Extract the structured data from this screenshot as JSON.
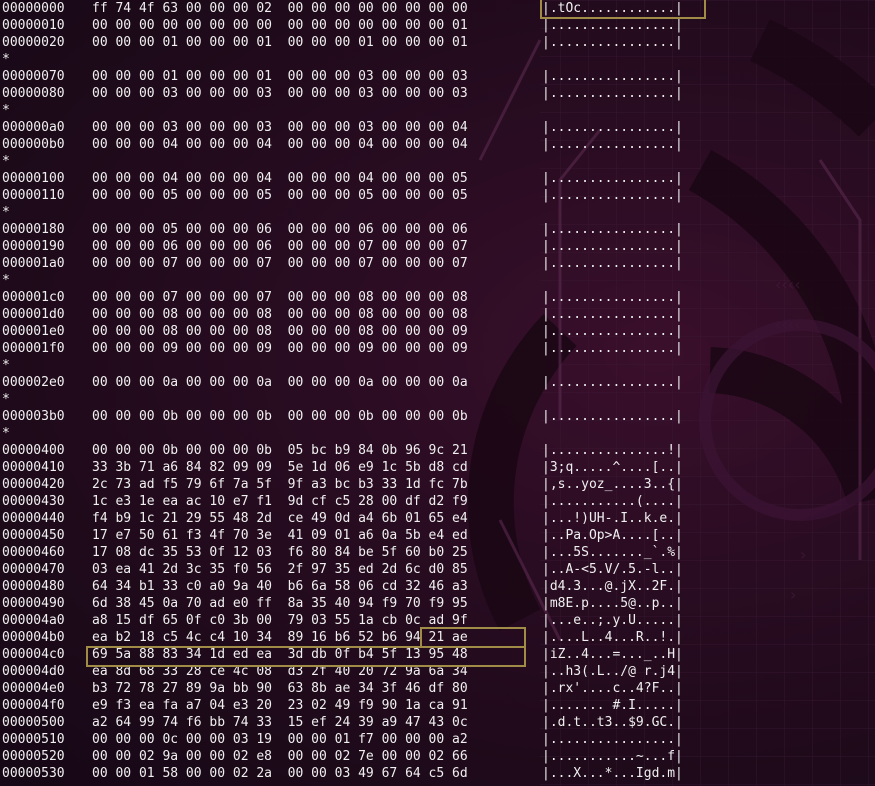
{
  "hexdump": {
    "lines": [
      {
        "offset": "00000000",
        "hex": "ff 74 4f 63 00 00 00 02  00 00 00 00 00 00 00 00",
        "ascii": "|.tOc............|"
      },
      {
        "offset": "00000010",
        "hex": "00 00 00 00 00 00 00 00  00 00 00 00 00 00 00 01",
        "ascii": "|................|"
      },
      {
        "offset": "00000020",
        "hex": "00 00 00 01 00 00 00 01  00 00 00 01 00 00 00 01",
        "ascii": "|................|"
      },
      {
        "offset": "*",
        "hex": "",
        "ascii": ""
      },
      {
        "offset": "00000070",
        "hex": "00 00 00 01 00 00 00 01  00 00 00 03 00 00 00 03",
        "ascii": "|................|"
      },
      {
        "offset": "00000080",
        "hex": "00 00 00 03 00 00 00 03  00 00 00 03 00 00 00 03",
        "ascii": "|................|"
      },
      {
        "offset": "*",
        "hex": "",
        "ascii": ""
      },
      {
        "offset": "000000a0",
        "hex": "00 00 00 03 00 00 00 03  00 00 00 03 00 00 00 04",
        "ascii": "|................|"
      },
      {
        "offset": "000000b0",
        "hex": "00 00 00 04 00 00 00 04  00 00 00 04 00 00 00 04",
        "ascii": "|................|"
      },
      {
        "offset": "*",
        "hex": "",
        "ascii": ""
      },
      {
        "offset": "00000100",
        "hex": "00 00 00 04 00 00 00 04  00 00 00 04 00 00 00 05",
        "ascii": "|................|"
      },
      {
        "offset": "00000110",
        "hex": "00 00 00 05 00 00 00 05  00 00 00 05 00 00 00 05",
        "ascii": "|................|"
      },
      {
        "offset": "*",
        "hex": "",
        "ascii": ""
      },
      {
        "offset": "00000180",
        "hex": "00 00 00 05 00 00 00 06  00 00 00 06 00 00 00 06",
        "ascii": "|................|"
      },
      {
        "offset": "00000190",
        "hex": "00 00 00 06 00 00 00 06  00 00 00 07 00 00 00 07",
        "ascii": "|................|"
      },
      {
        "offset": "000001a0",
        "hex": "00 00 00 07 00 00 00 07  00 00 00 07 00 00 00 07",
        "ascii": "|................|"
      },
      {
        "offset": "*",
        "hex": "",
        "ascii": ""
      },
      {
        "offset": "000001c0",
        "hex": "00 00 00 07 00 00 00 07  00 00 00 08 00 00 00 08",
        "ascii": "|................|"
      },
      {
        "offset": "000001d0",
        "hex": "00 00 00 08 00 00 00 08  00 00 00 08 00 00 00 08",
        "ascii": "|................|"
      },
      {
        "offset": "000001e0",
        "hex": "00 00 00 08 00 00 00 08  00 00 00 08 00 00 00 09",
        "ascii": "|................|"
      },
      {
        "offset": "000001f0",
        "hex": "00 00 00 09 00 00 00 09  00 00 00 09 00 00 00 09",
        "ascii": "|................|"
      },
      {
        "offset": "*",
        "hex": "",
        "ascii": ""
      },
      {
        "offset": "000002e0",
        "hex": "00 00 00 0a 00 00 00 0a  00 00 00 0a 00 00 00 0a",
        "ascii": "|................|"
      },
      {
        "offset": "*",
        "hex": "",
        "ascii": ""
      },
      {
        "offset": "000003b0",
        "hex": "00 00 00 0b 00 00 00 0b  00 00 00 0b 00 00 00 0b",
        "ascii": "|................|"
      },
      {
        "offset": "*",
        "hex": "",
        "ascii": ""
      },
      {
        "offset": "00000400",
        "hex": "00 00 00 0b 00 00 00 0b  05 bc b9 84 0b 96 9c 21",
        "ascii": "|...............!|"
      },
      {
        "offset": "00000410",
        "hex": "33 3b 71 a6 84 82 09 09  5e 1d 06 e9 1c 5b d8 cd",
        "ascii": "|3;q.....^....[..|"
      },
      {
        "offset": "00000420",
        "hex": "2c 73 ad f5 79 6f 7a 5f  9f a3 bc b3 33 1d fc 7b",
        "ascii": "|,s..yoz_....3..{|"
      },
      {
        "offset": "00000430",
        "hex": "1c e3 1e ea ac 10 e7 f1  9d cf c5 28 00 df d2 f9",
        "ascii": "|...........(....|"
      },
      {
        "offset": "00000440",
        "hex": "f4 b9 1c 21 29 55 48 2d  ce 49 0d a4 6b 01 65 e4",
        "ascii": "|...!)UH-.I..k.e.|"
      },
      {
        "offset": "00000450",
        "hex": "17 e7 50 61 f3 4f 70 3e  41 09 01 a6 0a 5b e4 ed",
        "ascii": "|..Pa.Op>A....[..|"
      },
      {
        "offset": "00000460",
        "hex": "17 08 dc 35 53 0f 12 03  f6 80 84 be 5f 60 b0 25",
        "ascii": "|...5S......._`.%|"
      },
      {
        "offset": "00000470",
        "hex": "03 ea 41 2d 3c 35 f0 56  2f 97 35 ed 2d 6c d0 85",
        "ascii": "|..A-<5.V/.5.-l..|"
      },
      {
        "offset": "00000480",
        "hex": "64 34 b1 33 c0 a0 9a 40  b6 6a 58 06 cd 32 46 a3",
        "ascii": "|d4.3...@.jX..2F.|"
      },
      {
        "offset": "00000490",
        "hex": "6d 38 45 0a 70 ad e0 ff  8a 35 40 94 f9 70 f9 95",
        "ascii": "|m8E.p....5@..p..|"
      },
      {
        "offset": "000004a0",
        "hex": "a8 15 df 65 0f c0 3b 00  79 03 55 1a cb 0c ad 9f",
        "ascii": "|...e..;.y.U.....|"
      },
      {
        "offset": "000004b0",
        "hex": "ea b2 18 c5 4c c4 10 34  89 16 b6 52 b6 94 21 ae",
        "ascii": "|....L..4...R..!.|"
      },
      {
        "offset": "000004c0",
        "hex": "69 5a 88 83 34 1d ed ea  3d db 0f b4 5f 13 95 48",
        "ascii": "|iZ..4...=..._..H|"
      },
      {
        "offset": "000004d0",
        "hex": "ea 8d 68 33 28 ce 4c 08  d3 2f 40 20 72 9a 6a 34",
        "ascii": "|..h3(.L../@ r.j4|"
      },
      {
        "offset": "000004e0",
        "hex": "b3 72 78 27 89 9a bb 90  63 8b ae 34 3f 46 df 80",
        "ascii": "|.rx'....c..4?F..|"
      },
      {
        "offset": "000004f0",
        "hex": "e9 f3 ea fa a7 04 e3 20  23 02 49 f9 90 1a ca 91",
        "ascii": "|....... #.I.....|"
      },
      {
        "offset": "00000500",
        "hex": "a2 64 99 74 f6 bb 74 33  15 ef 24 39 a9 47 43 0c",
        "ascii": "|.d.t..t3..$9.GC.|"
      },
      {
        "offset": "00000510",
        "hex": "00 00 00 0c 00 00 03 19  00 00 01 f7 00 00 00 a2",
        "ascii": "|................|"
      },
      {
        "offset": "00000520",
        "hex": "00 00 02 9a 00 00 02 e8  00 00 02 7e 00 00 02 66",
        "ascii": "|...........~...f|"
      },
      {
        "offset": "00000530",
        "hex": "00 00 01 58 00 00 02 2a  00 00 03 49 67 64 c5 6d",
        "ascii": "|...X...*...Igd.m|"
      }
    ]
  },
  "highlight_color": "#a08c46",
  "text_color": "#f0f0f0",
  "background_color": "#2a0c22"
}
